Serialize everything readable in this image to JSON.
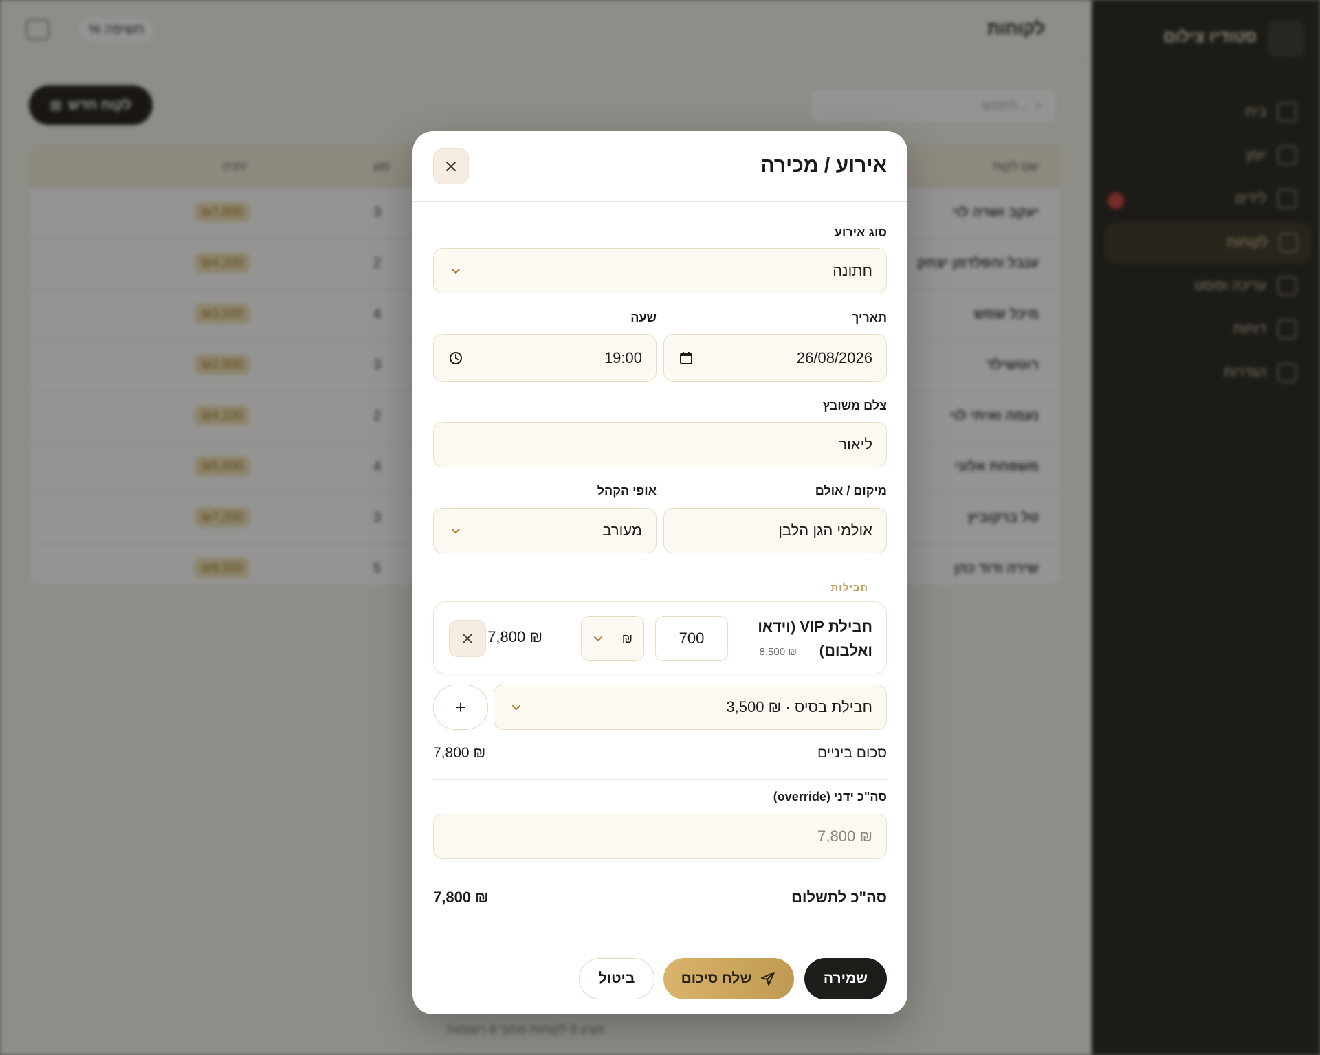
{
  "background": {
    "page_title": "לקוחות",
    "top_pill": "% חשיפה",
    "new_button": "לקוח חדש",
    "search_placeholder": "חיפוש...",
    "brand": "סטודיו צילום",
    "nav": [
      {
        "label": "בית"
      },
      {
        "label": "יומן"
      },
      {
        "label": "לידים"
      },
      {
        "label": "לקוחות"
      },
      {
        "label": "עריכה ופוסט"
      },
      {
        "label": "דוחות"
      },
      {
        "label": "הגדרות"
      }
    ],
    "table": {
      "headers": [
        "שם לקוח",
        "סוג",
        "יתרה"
      ],
      "rows": [
        {
          "name": "יעקב ושרה לוי",
          "num": "3",
          "badge": "₪7,800"
        },
        {
          "name": "ענבל והפלדמן יצחק",
          "num": "2",
          "badge": "₪4,200"
        },
        {
          "name": "מיכל שמש",
          "num": "4",
          "badge": "₪3,500"
        },
        {
          "name": "רוטשילד",
          "num": "3",
          "badge": "₪2,900"
        },
        {
          "name": "נעמה ואיתי לוי",
          "num": "2",
          "badge": "₪4,100"
        },
        {
          "name": "משפחת אלוני",
          "num": "4",
          "badge": "₪5,600"
        },
        {
          "name": "טל ברקוביץ",
          "num": "3",
          "badge": "₪7,200"
        },
        {
          "name": "שירה ודוד כהן",
          "num": "5",
          "badge": "₪8,500"
        }
      ]
    },
    "footer_note": "מציג 8 לקוחות מתוך 8 רשומות"
  },
  "modal": {
    "title": "אירוע / מכירה",
    "event_type": {
      "label": "סוג אירוע",
      "value": "חתונה"
    },
    "date": {
      "label": "תאריך",
      "value": "26/08/2026"
    },
    "time": {
      "label": "שעה",
      "value": "19:00"
    },
    "photographer": {
      "label": "צלם משובץ",
      "value": "ליאור"
    },
    "venue": {
      "label": "מיקום / אולם",
      "value": "אולמי הגן הלבן"
    },
    "audience": {
      "label": "אופי הקהל",
      "value": "מעורב"
    },
    "packages_label": "חבילות",
    "package": {
      "name": "חבילת VIP (וידאו ואלבום)",
      "base_price": "₪ 8,500",
      "quantity": "700",
      "currency": "₪",
      "total": "₪ 7,800"
    },
    "package_select": {
      "value": "חבילת בסיס · ₪ 3,500"
    },
    "add_label": "+",
    "subtotal": {
      "label": "סכום ביניים",
      "value": "₪ 7,800"
    },
    "override": {
      "label": "סה\"כ ידני (override)",
      "placeholder": "₪ 7,800"
    },
    "grand_total": {
      "label": "סה\"כ לתשלום",
      "value": "₪ 7,800"
    },
    "buttons": {
      "save": "שמירה",
      "send_summary": "שלח סיכום",
      "cancel": "ביטול"
    }
  },
  "colors": {
    "accent_gold": "#c49a4e",
    "dark": "#1f1d19",
    "input_bg": "#fcf9f3",
    "input_border": "#e8dcc4"
  }
}
